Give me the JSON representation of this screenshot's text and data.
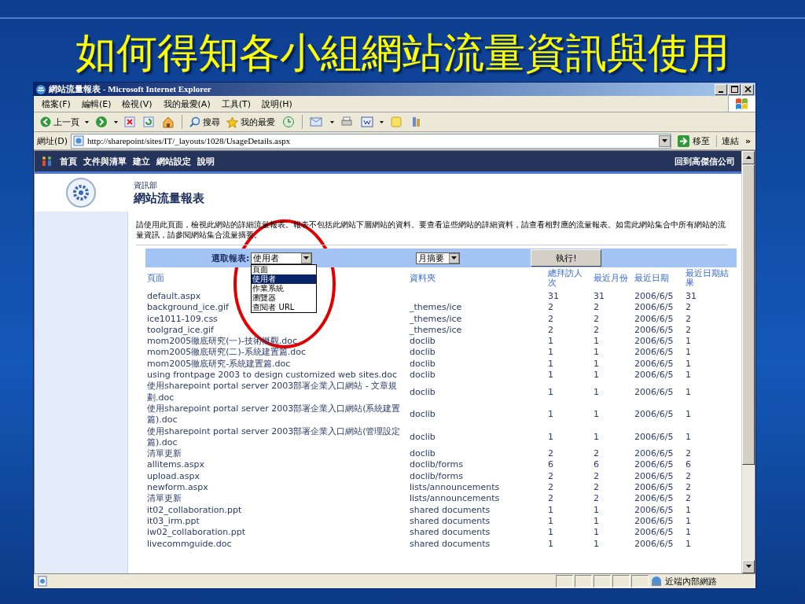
{
  "slide_title": "如何得知各小組網站流量資訊與使用",
  "window": {
    "title": "網站流量報表 - Microsoft Internet Explorer"
  },
  "menu": [
    "檔案(F)",
    "編輯(E)",
    "檢視(V)",
    "我的最愛(A)",
    "工具(T)",
    "說明(H)"
  ],
  "toolbar": {
    "back": "上一頁",
    "search": "搜尋",
    "favorites": "我的最愛"
  },
  "address": {
    "label": "網址(D)",
    "value": "http://sharepoint/sites/IT/_layouts/1028/UsageDetails.aspx",
    "go": "移至",
    "links": "連結",
    "more": "»"
  },
  "nav": {
    "items": [
      "首頁",
      "文件與清單",
      "建立",
      "網站設定",
      "說明"
    ],
    "back_link": "回到高傑信公司"
  },
  "header": {
    "site": "資訊部",
    "title": "網站流量報表"
  },
  "description": "請使用此頁面，檢視此網站的詳細流量報表。報表不包括此網站下層網站的資料。要查看這些網站的詳細資料，請查看相對應的流量報表。如需此網站集合中所有網站的流量資訊，請參閱網站集合流量摘要。",
  "form": {
    "label": "選取報表:",
    "report_select": "使用者",
    "options": [
      {
        "label": "頁面",
        "selected": false
      },
      {
        "label": "使用者",
        "selected": true
      },
      {
        "label": "作業系統",
        "selected": false
      },
      {
        "label": "瀏覽器",
        "selected": false
      },
      {
        "label": "查閱者 URL",
        "selected": false
      }
    ],
    "period_select": "月摘要",
    "run_button": "執行!"
  },
  "table": {
    "columns": [
      "頁面",
      "資料夾",
      "總拜訪人次",
      "最近月份",
      "最近日期",
      "最近日期結果"
    ],
    "rows": [
      [
        "default.aspx",
        "",
        "31",
        "31",
        "2006/6/5",
        "31"
      ],
      [
        "background_ice.gif",
        "_themes/ice",
        "2",
        "2",
        "2006/6/5",
        "2"
      ],
      [
        "ice1011-109.css",
        "_themes/ice",
        "2",
        "2",
        "2006/6/5",
        "2"
      ],
      [
        "toolgrad_ice.gif",
        "_themes/ice",
        "2",
        "2",
        "2006/6/5",
        "2"
      ],
      [
        "mom2005徹底研究(一)-技術概觀.doc",
        "doclib",
        "1",
        "1",
        "2006/6/5",
        "1"
      ],
      [
        "mom2005徹底研究(二)-系統建置篇.doc",
        "doclib",
        "1",
        "1",
        "2006/6/5",
        "1"
      ],
      [
        "mom2005徹底研究-系統建置篇.doc",
        "doclib",
        "1",
        "1",
        "2006/6/5",
        "1"
      ],
      [
        "using frontpage 2003 to design customized web sites.doc",
        "doclib",
        "1",
        "1",
        "2006/6/5",
        "1"
      ],
      [
        "使用sharepoint portal server 2003部署企業入口網站 - 文章規劃.doc",
        "doclib",
        "1",
        "1",
        "2006/6/5",
        "1"
      ],
      [
        "使用sharepoint portal server 2003部署企業入口網站(系統建置篇).doc",
        "doclib",
        "1",
        "1",
        "2006/6/5",
        "1"
      ],
      [
        "使用sharepoint portal server 2003部署企業入口網站(管理設定篇).doc",
        "doclib",
        "1",
        "1",
        "2006/6/5",
        "1"
      ],
      [
        "清單更新",
        "doclib",
        "2",
        "2",
        "2006/6/5",
        "2"
      ],
      [
        "allitems.aspx",
        "doclib/forms",
        "6",
        "6",
        "2006/6/5",
        "6"
      ],
      [
        "upload.aspx",
        "doclib/forms",
        "2",
        "2",
        "2006/6/5",
        "2"
      ],
      [
        "newform.aspx",
        "lists/announcements",
        "2",
        "2",
        "2006/6/5",
        "2"
      ],
      [
        "清單更新",
        "lists/announcements",
        "2",
        "2",
        "2006/6/5",
        "2"
      ],
      [
        "it02_collaboration.ppt",
        "shared documents",
        "1",
        "1",
        "2006/6/5",
        "1"
      ],
      [
        "it03_irm.ppt",
        "shared documents",
        "1",
        "1",
        "2006/6/5",
        "1"
      ],
      [
        "iw02_collaboration.ppt",
        "shared documents",
        "1",
        "1",
        "2006/6/5",
        "1"
      ],
      [
        "livecommguide.doc",
        "shared documents",
        "1",
        "1",
        "2006/6/5",
        "1"
      ]
    ]
  },
  "status_bar": {
    "zone": "近端內部網路"
  }
}
